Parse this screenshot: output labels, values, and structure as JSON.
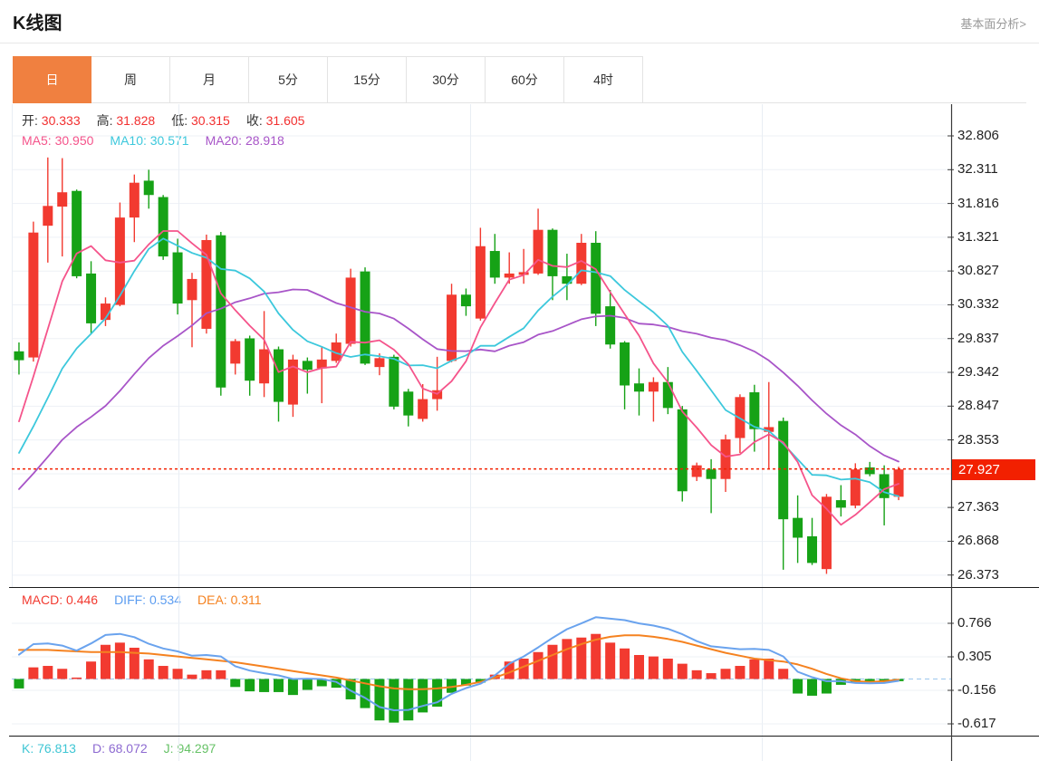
{
  "page": {
    "title": "K线图",
    "fundamental_link": "基本面分析>"
  },
  "tabs": {
    "items": [
      "日",
      "周",
      "月",
      "5分",
      "15分",
      "30分",
      "60分",
      "4时"
    ],
    "active_index": 0
  },
  "legend": {
    "ohlc": [
      {
        "label": "开:",
        "value": "30.333"
      },
      {
        "label": "高:",
        "value": "31.828"
      },
      {
        "label": "低:",
        "value": "30.315"
      },
      {
        "label": "收:",
        "value": "31.605"
      }
    ],
    "ma": [
      {
        "label": "MA5:",
        "value": "30.950",
        "color": "#f5548b"
      },
      {
        "label": "MA10:",
        "value": "30.571",
        "color": "#3cc8dc"
      },
      {
        "label": "MA20:",
        "value": "28.918",
        "color": "#a855c8"
      }
    ]
  },
  "macd_legend": [
    {
      "label": "MACD:",
      "value": "0.446",
      "color": "#f23a30"
    },
    {
      "label": "DIFF:",
      "value": "0.534",
      "color": "#5b9cf0"
    },
    {
      "label": "DEA:",
      "value": "0.311",
      "color": "#f58220"
    }
  ],
  "kdj_legend": [
    {
      "label": "K:",
      "value": "76.813",
      "color": "#3fc6d4"
    },
    {
      "label": "D:",
      "value": "68.072",
      "color": "#8d6ad1"
    },
    {
      "label": "J:",
      "value": "94.297",
      "color": "#67c267"
    }
  ],
  "y_axis": {
    "price_ticks": [
      "32.806",
      "32.311",
      "31.816",
      "31.321",
      "30.827",
      "30.332",
      "29.837",
      "29.342",
      "28.847",
      "28.353",
      "27.363",
      "26.868",
      "26.373"
    ],
    "current_price": "27.927",
    "macd_ticks": [
      "0.766",
      "0.305",
      "-0.156",
      "-0.617"
    ]
  },
  "colors": {
    "up": "#f23a30",
    "down": "#16a216",
    "ohlc_value": "#f22f2f",
    "ma5": "#f5548b",
    "ma10": "#3cc8dc",
    "ma20": "#a855c8",
    "diff": "#6aa3ee",
    "dea": "#f58220",
    "badge": "#f22000",
    "tab_active": "#f08040",
    "grid": "#edf1f6",
    "vgrid": "#e9eef4",
    "axis": "#3a3a3a",
    "zero_dash": "#a9cdf0"
  },
  "chart_data": {
    "type": "candlestick",
    "title": "K线图 日K",
    "price_axis_range": [
      26.2,
      33.27
    ],
    "price_tick_step": 0.495,
    "price_tick_top": 32.806,
    "current_price": 27.927,
    "candles": [
      [
        29.65,
        29.78,
        29.31,
        29.52
      ],
      [
        29.56,
        31.55,
        29.5,
        31.39
      ],
      [
        31.49,
        32.49,
        30.95,
        31.78
      ],
      [
        31.77,
        32.48,
        31.04,
        31.98
      ],
      [
        32.0,
        32.02,
        30.72,
        30.75
      ],
      [
        30.79,
        30.97,
        29.91,
        30.06
      ],
      [
        30.11,
        30.44,
        30.02,
        30.35
      ],
      [
        30.33,
        31.83,
        30.31,
        31.61
      ],
      [
        31.61,
        32.24,
        31.25,
        32.12
      ],
      [
        32.15,
        32.31,
        31.74,
        31.94
      ],
      [
        31.91,
        31.94,
        30.99,
        31.04
      ],
      [
        31.1,
        31.3,
        30.19,
        30.35
      ],
      [
        30.4,
        30.8,
        29.71,
        30.71
      ],
      [
        29.98,
        31.36,
        29.91,
        31.28
      ],
      [
        31.35,
        31.4,
        29.0,
        29.12
      ],
      [
        29.47,
        29.83,
        29.31,
        29.8
      ],
      [
        29.84,
        29.88,
        29.0,
        29.22
      ],
      [
        29.18,
        30.24,
        28.98,
        29.68
      ],
      [
        29.68,
        29.72,
        28.62,
        28.91
      ],
      [
        28.87,
        29.6,
        28.69,
        29.53
      ],
      [
        29.51,
        29.56,
        29.03,
        29.38
      ],
      [
        29.4,
        29.71,
        28.89,
        29.53
      ],
      [
        29.51,
        29.91,
        29.48,
        29.78
      ],
      [
        29.76,
        30.86,
        29.72,
        30.73
      ],
      [
        30.82,
        30.88,
        29.45,
        29.47
      ],
      [
        29.42,
        29.62,
        29.3,
        29.55
      ],
      [
        29.57,
        29.6,
        28.8,
        28.84
      ],
      [
        29.06,
        29.1,
        28.55,
        28.71
      ],
      [
        28.66,
        29.17,
        28.62,
        28.95
      ],
      [
        28.95,
        29.57,
        28.78,
        29.08
      ],
      [
        29.51,
        30.64,
        29.49,
        30.48
      ],
      [
        30.48,
        30.57,
        30.17,
        30.31
      ],
      [
        30.13,
        31.46,
        30.1,
        31.19
      ],
      [
        31.12,
        31.37,
        30.64,
        30.73
      ],
      [
        30.73,
        31.1,
        30.64,
        30.79
      ],
      [
        30.77,
        31.15,
        30.64,
        30.81
      ],
      [
        30.79,
        31.74,
        30.77,
        31.43
      ],
      [
        31.43,
        31.45,
        30.4,
        30.75
      ],
      [
        30.75,
        31.08,
        30.4,
        30.64
      ],
      [
        30.64,
        31.37,
        30.62,
        31.24
      ],
      [
        31.24,
        31.41,
        30.02,
        30.2
      ],
      [
        30.31,
        30.55,
        29.69,
        29.75
      ],
      [
        29.78,
        29.8,
        28.8,
        29.15
      ],
      [
        29.18,
        29.4,
        28.71,
        29.06
      ],
      [
        29.06,
        29.27,
        28.62,
        29.2
      ],
      [
        29.2,
        29.42,
        28.73,
        28.82
      ],
      [
        28.8,
        28.85,
        27.45,
        27.6
      ],
      [
        27.81,
        28.02,
        27.75,
        27.98
      ],
      [
        27.92,
        28.07,
        27.28,
        27.78
      ],
      [
        27.78,
        28.43,
        27.59,
        28.36
      ],
      [
        28.38,
        29.02,
        28.16,
        28.98
      ],
      [
        29.05,
        29.16,
        28.18,
        28.51
      ],
      [
        28.47,
        29.2,
        27.92,
        28.54
      ],
      [
        28.63,
        28.68,
        26.45,
        27.19
      ],
      [
        27.21,
        27.54,
        26.55,
        26.92
      ],
      [
        26.94,
        27.21,
        26.52,
        26.55
      ],
      [
        26.46,
        27.56,
        26.39,
        27.52
      ],
      [
        27.47,
        27.69,
        27.23,
        27.36
      ],
      [
        27.39,
        28.01,
        27.35,
        27.92
      ],
      [
        27.95,
        28.03,
        27.82,
        27.85
      ],
      [
        27.85,
        27.98,
        27.1,
        27.5
      ],
      [
        27.52,
        27.96,
        27.47,
        27.92
      ]
    ],
    "ma_periods": [
      5,
      10,
      20
    ],
    "ma_seed_prehistory": [
      26.8,
      26.9,
      27.0,
      27.0,
      27.1,
      27.1,
      27.2,
      27.2,
      27.3,
      27.4,
      27.5,
      27.6,
      27.7,
      27.8,
      27.9,
      28.1,
      28.3,
      28.5,
      28.7
    ],
    "macd": {
      "axis_range": [
        -0.617,
        0.766
      ],
      "hist": [
        -0.13,
        0.16,
        0.18,
        0.14,
        0.02,
        0.24,
        0.47,
        0.5,
        0.43,
        0.27,
        0.18,
        0.14,
        0.06,
        0.12,
        0.12,
        -0.11,
        -0.17,
        -0.18,
        -0.18,
        -0.22,
        -0.15,
        -0.1,
        -0.12,
        -0.28,
        -0.4,
        -0.57,
        -0.6,
        -0.57,
        -0.46,
        -0.38,
        -0.19,
        -0.09,
        -0.05,
        0.06,
        0.24,
        0.28,
        0.37,
        0.47,
        0.55,
        0.57,
        0.62,
        0.5,
        0.42,
        0.33,
        0.31,
        0.28,
        0.21,
        0.12,
        0.08,
        0.14,
        0.18,
        0.27,
        0.28,
        0.14,
        -0.2,
        -0.23,
        -0.2,
        -0.08,
        -0.05,
        -0.04,
        -0.05,
        -0.03
      ],
      "dea": [
        0.4,
        0.4,
        0.4,
        0.39,
        0.38,
        0.37,
        0.37,
        0.37,
        0.36,
        0.35,
        0.33,
        0.31,
        0.29,
        0.27,
        0.25,
        0.23,
        0.2,
        0.17,
        0.14,
        0.11,
        0.08,
        0.05,
        0.02,
        -0.02,
        -0.06,
        -0.1,
        -0.13,
        -0.14,
        -0.14,
        -0.13,
        -0.11,
        -0.08,
        -0.04,
        0.02,
        0.09,
        0.17,
        0.25,
        0.33,
        0.41,
        0.48,
        0.54,
        0.58,
        0.6,
        0.6,
        0.58,
        0.55,
        0.51,
        0.46,
        0.41,
        0.36,
        0.32,
        0.28,
        0.26,
        0.24,
        0.2,
        0.14,
        0.07,
        0.01,
        -0.03,
        -0.04,
        -0.03,
        -0.01
      ]
    }
  }
}
